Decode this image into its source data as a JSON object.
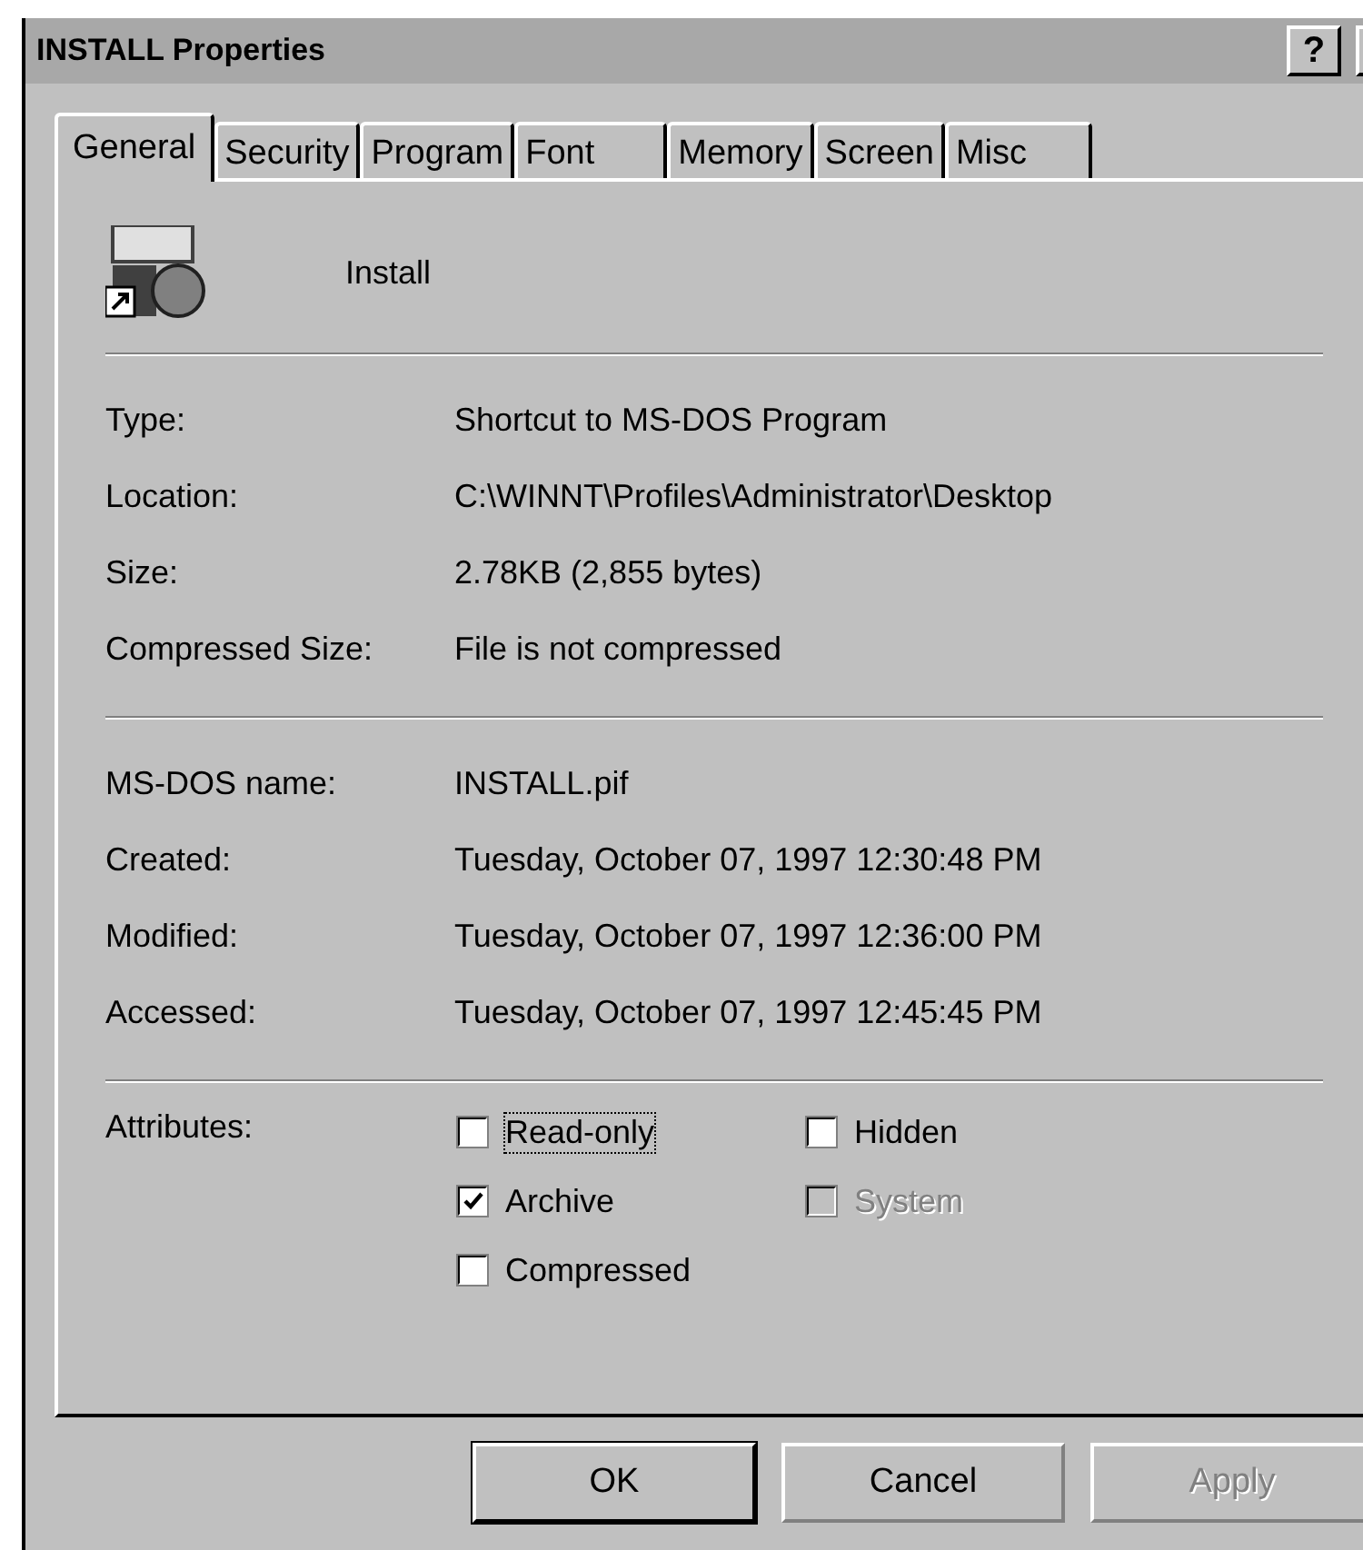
{
  "window": {
    "title": "INSTALL Properties",
    "help_button": "?"
  },
  "tabs": [
    {
      "label": "General",
      "selected": true
    },
    {
      "label": "Security",
      "selected": false
    },
    {
      "label": "Program",
      "selected": false
    },
    {
      "label": "Font",
      "selected": false
    },
    {
      "label": "Memory",
      "selected": false
    },
    {
      "label": "Screen",
      "selected": false
    },
    {
      "label": "Misc",
      "selected": false
    }
  ],
  "file": {
    "name": "Install"
  },
  "sections": [
    [
      {
        "label": "Type:",
        "value": "Shortcut to MS-DOS Program"
      },
      {
        "label": "Location:",
        "value": "C:\\WINNT\\Profiles\\Administrator\\Desktop"
      },
      {
        "label": "Size:",
        "value": "2.78KB (2,855 bytes)"
      },
      {
        "label": "Compressed Size:",
        "value": "File is not compressed"
      }
    ],
    [
      {
        "label": "MS-DOS name:",
        "value": "INSTALL.pif"
      },
      {
        "label": "Created:",
        "value": "Tuesday, October 07, 1997 12:30:48 PM"
      },
      {
        "label": "Modified:",
        "value": "Tuesday, October 07, 1997 12:36:00 PM"
      },
      {
        "label": "Accessed:",
        "value": "Tuesday, October 07, 1997 12:45:45 PM"
      }
    ]
  ],
  "attributes": {
    "label": "Attributes:",
    "options": [
      {
        "label": "Read-only",
        "checked": false,
        "disabled": false,
        "focused": true
      },
      {
        "label": "Hidden",
        "checked": false,
        "disabled": false,
        "focused": false
      },
      {
        "label": "Archive",
        "checked": true,
        "disabled": false,
        "focused": false
      },
      {
        "label": "System",
        "checked": false,
        "disabled": true,
        "focused": false
      },
      {
        "label": "Compressed",
        "checked": false,
        "disabled": false,
        "focused": false
      }
    ]
  },
  "buttons": [
    {
      "label": "OK",
      "default": true,
      "disabled": false
    },
    {
      "label": "Cancel",
      "default": false,
      "disabled": false
    },
    {
      "label": "Apply",
      "default": false,
      "disabled": true
    }
  ]
}
